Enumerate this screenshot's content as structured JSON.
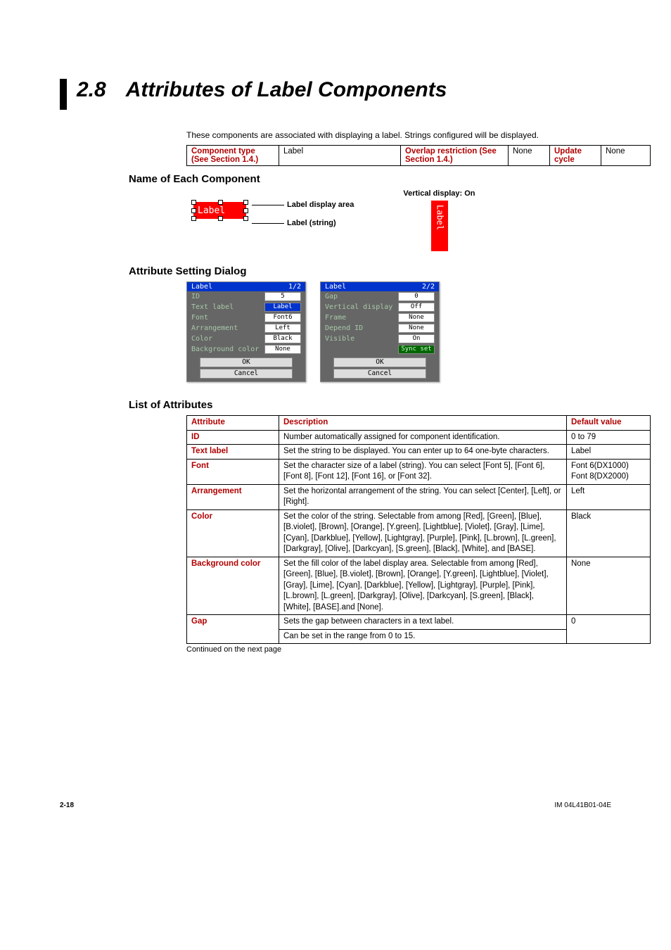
{
  "section": {
    "number": "2.8",
    "title": "Attributes of Label Components"
  },
  "intro": "These components are associated with displaying a label. Strings configured will be displayed.",
  "info": {
    "h_component": "Component type (See Section 1.4.)",
    "v_component": "Label",
    "h_overlap": "Overlap restriction (See Section 1.4.)",
    "v_overlap": "None",
    "h_update": "Update cycle",
    "v_update": "None"
  },
  "headings": {
    "name": "Name of Each Component",
    "dialog": "Attribute Setting Dialog",
    "list": "List of Attributes"
  },
  "component": {
    "label_text": "Label",
    "callout_area": "Label display area",
    "callout_string": "Label (string)",
    "vertical_caption": "Vertical display: On",
    "vertical_text": "Label"
  },
  "dialog1": {
    "title": "Label",
    "page": "1/2",
    "rows": [
      {
        "k": "ID",
        "v": "5",
        "sel": false
      },
      {
        "k": "Text label",
        "v": "Label",
        "sel": true
      },
      {
        "k": "Font",
        "v": "Font6",
        "sel": false
      },
      {
        "k": "Arrangement",
        "v": "Left",
        "sel": false
      },
      {
        "k": "Color",
        "v": "Black",
        "sel": false
      },
      {
        "k": "Background color",
        "v": "None",
        "sel": false
      }
    ],
    "ok": "OK",
    "cancel": "Cancel"
  },
  "dialog2": {
    "title": "Label",
    "page": "2/2",
    "rows": [
      {
        "k": "Gap",
        "v": "0",
        "sel": false
      },
      {
        "k": "Vertical display",
        "v": "Off",
        "sel": false
      },
      {
        "k": "Frame",
        "v": "None",
        "sel": false
      },
      {
        "k": "Depend ID",
        "v": "None",
        "sel": false
      },
      {
        "k": "Visible",
        "v": "On",
        "sel": false
      }
    ],
    "sync": "Sync set",
    "ok": "OK",
    "cancel": "Cancel"
  },
  "attr_headers": {
    "attr": "Attribute",
    "desc": "Description",
    "def": "Default value"
  },
  "attrs": [
    {
      "name": "ID",
      "desc": "Number automatically assigned for component identification.",
      "def": "0 to 79"
    },
    {
      "name": "Text label",
      "desc": "Set the string to be displayed. You can enter up to 64 one-byte characters.",
      "def": "Label"
    },
    {
      "name": "Font",
      "desc": "Set the character size of a label (string). You can select [Font 5], [Font 6], [Font 8], [Font 12], [Font 16], or [Font 32].",
      "def": "Font 6(DX1000) Font 8(DX2000)"
    },
    {
      "name": "Arrangement",
      "desc": "Set the horizontal arrangement of the string. You can select [Center], [Left], or [Right].",
      "def": "Left"
    },
    {
      "name": "Color",
      "desc": "Set the color of the string. Selectable from among [Red], [Green], [Blue], [B.violet], [Brown], [Orange], [Y.green], [Lightblue], [Violet], [Gray], [Lime], [Cyan], [Darkblue], [Yellow], [Lightgray], [Purple], [Pink], [L.brown], [L.green], [Darkgray], [Olive], [Darkcyan], [S.green], [Black], [White], and [BASE].",
      "def": "Black"
    },
    {
      "name": "Background color",
      "desc": "Set the fill color of the label display area. Selectable from among [Red], [Green], [Blue], [B.violet], [Brown], [Orange], [Y.green], [Lightblue], [Violet], [Gray], [Lime], [Cyan], [Darkblue], [Yellow], [Lightgray], [Purple], [Pink], [L.brown], [L.green], [Darkgray], [Olive], [Darkcyan], [S.green], [Black], [White], [BASE].and [None].",
      "def": "None"
    },
    {
      "name": "Gap",
      "desc": "Sets the gap between characters in a text label.",
      "def": "0"
    }
  ],
  "gap_extra": "Can be set in the range from 0 to 15.",
  "continued": "Continued on the next page",
  "footer": {
    "page": "2-18",
    "doc": "IM 04L41B01-04E"
  }
}
